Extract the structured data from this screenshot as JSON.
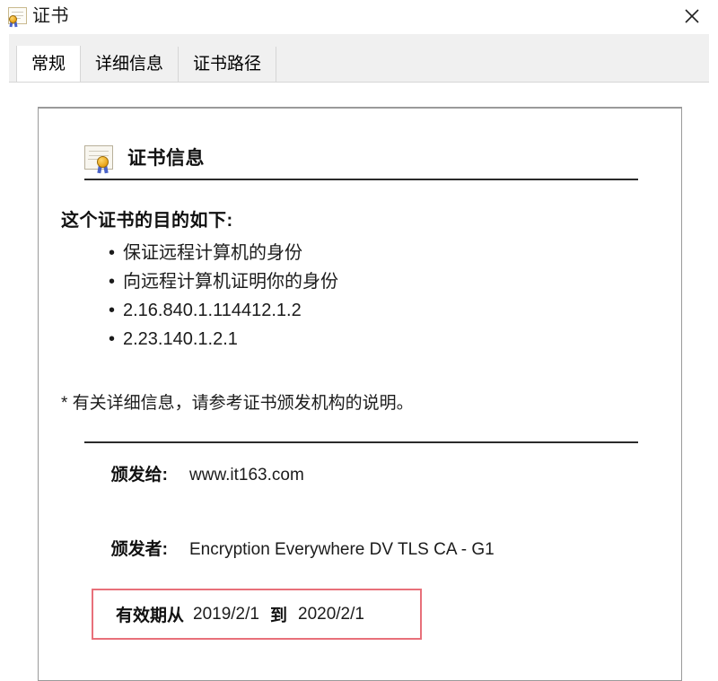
{
  "window": {
    "title": "证书",
    "icon": "certificate-icon",
    "close_label": "×"
  },
  "tabs": [
    {
      "label": "常规",
      "active": true
    },
    {
      "label": "详细信息",
      "active": false
    },
    {
      "label": "证书路径",
      "active": false
    }
  ],
  "panel": {
    "header_icon": "certificate-icon",
    "header_title": "证书信息",
    "purpose_title": "这个证书的目的如下:",
    "purposes": [
      "保证远程计算机的身份",
      "向远程计算机证明你的身份",
      "2.16.840.1.114412.1.2",
      "2.23.140.1.2.1"
    ],
    "footnote": "* 有关详细信息，请参考证书颁发机构的说明。",
    "issued_to_label": "颁发给:",
    "issued_to_value": "www.it163.com",
    "issued_by_label": "颁发者:",
    "issued_by_value": "Encryption Everywhere DV TLS CA - G1",
    "validity_label": "有效期从",
    "validity_from": "2019/2/1",
    "validity_sep": "到",
    "validity_to": "2020/2/1"
  },
  "colors": {
    "highlight_box": "#e8707a",
    "rule": "#2b2b2b",
    "panel_border": "#9a9a9a",
    "tabstrip_bg": "#f0f0f0",
    "seal_gold": "#e8a317",
    "ribbon_blue": "#4a63c8"
  }
}
